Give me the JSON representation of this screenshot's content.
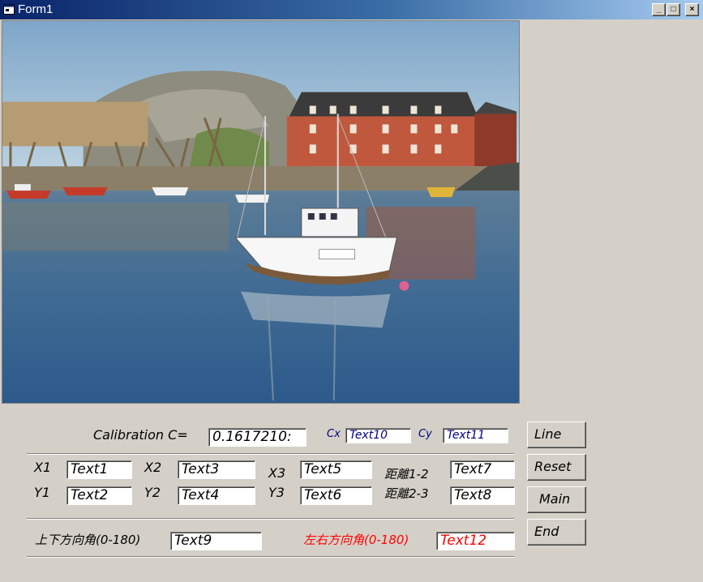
{
  "window": {
    "title": "Form1",
    "minimize_glyph": "_",
    "maximize_glyph": "□",
    "close_glyph": "×"
  },
  "calibration": {
    "label": "Calibration C=",
    "value": "0.1617210:",
    "cx_label": "Cx",
    "cx_value": "Text10",
    "cy_label": "Cy",
    "cy_value": "Text11"
  },
  "coords": {
    "x1_label": "X1",
    "x1_value": "Text1",
    "y1_label": "Y1",
    "y1_value": "Text2",
    "x2_label": "X2",
    "x2_value": "Text3",
    "y2_label": "Y2",
    "y2_value": "Text4",
    "x3_label": "X3",
    "x3_value": "Text5",
    "y3_label": "Y3",
    "y3_value": "Text6",
    "d12_label": "距離1-2",
    "d12_value": "Text7",
    "d23_label": "距離2-3",
    "d23_value": "Text8"
  },
  "angles": {
    "vertical_label": "上下方向角(0-180)",
    "vertical_value": "Text9",
    "horizontal_label": "左右方向角(0-180)",
    "horizontal_value": "Text12"
  },
  "buttons": {
    "line": "Line",
    "reset": "Reset",
    "main": "Main",
    "end": "End"
  },
  "colors": {
    "form_bg": "#d4d0c8",
    "cx_cy_text": "#00008b",
    "horizontal_angle": "#ff0000"
  }
}
